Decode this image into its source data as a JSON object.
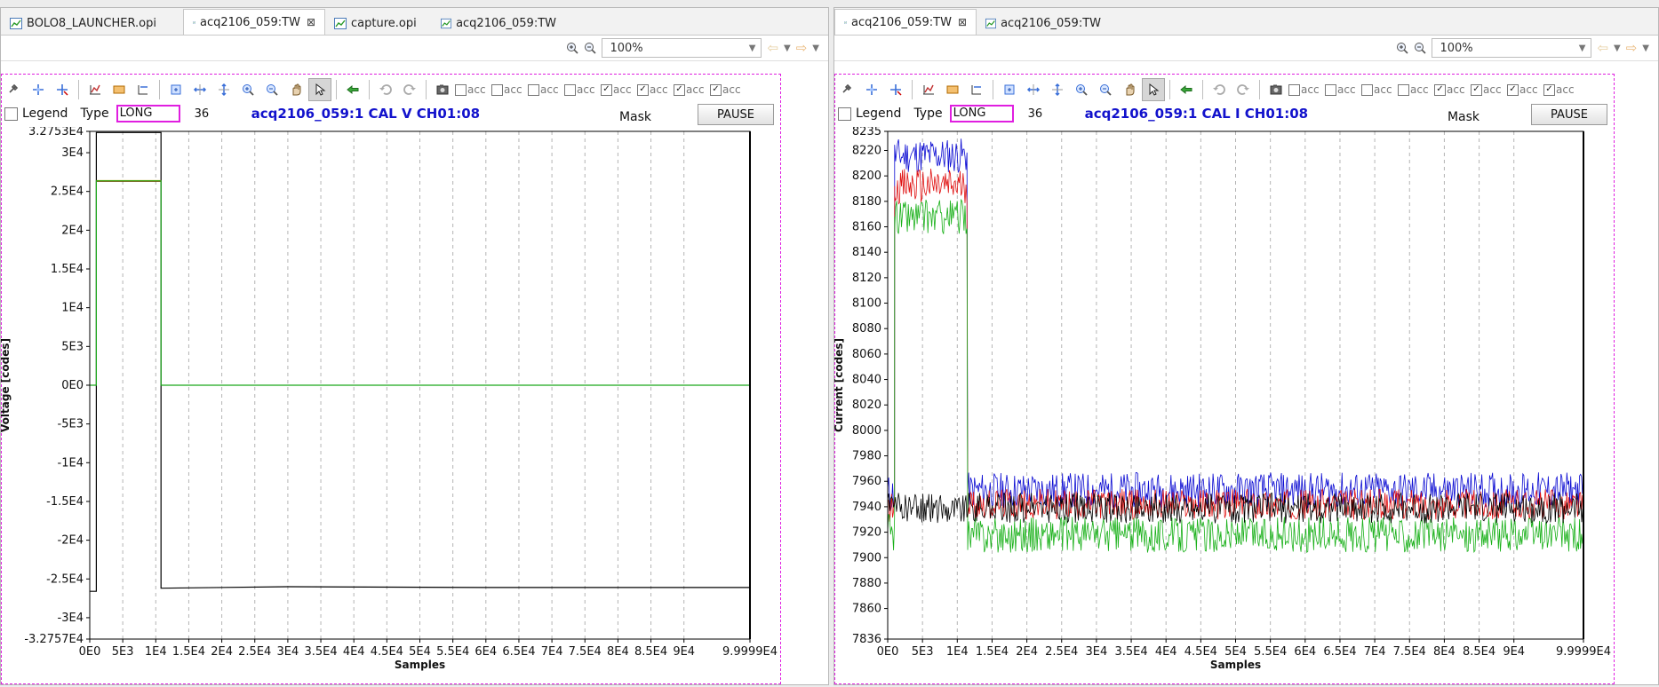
{
  "left": {
    "tabs": [
      {
        "label": "BOLO8_LAUNCHER.opi",
        "active": false,
        "closable": false
      },
      {
        "label": "acq2106_059:TW",
        "active": true,
        "closable": true
      },
      {
        "label": "capture.opi",
        "active": false,
        "closable": false
      },
      {
        "label": "acq2106_059:TW",
        "active": false,
        "closable": false
      }
    ],
    "zoom": "100%",
    "legend_label": "Legend",
    "type_label": "Type",
    "type_value": "LONG",
    "count_value": "36",
    "pv_title": "acq2106_059:1 CAL V CH01:08",
    "mask_label": "Mask",
    "pause_label": "PAUSE",
    "checks": [
      {
        "label": "acc",
        "checked": false
      },
      {
        "label": "acc",
        "checked": false
      },
      {
        "label": "acc",
        "checked": false
      },
      {
        "label": "acc",
        "checked": false
      },
      {
        "label": "acc",
        "checked": true
      },
      {
        "label": "acc",
        "checked": true
      },
      {
        "label": "acc",
        "checked": true
      },
      {
        "label": "acc",
        "checked": true
      }
    ]
  },
  "right": {
    "tabs": [
      {
        "label": "acq2106_059:TW",
        "active": true,
        "closable": true
      },
      {
        "label": "acq2106_059:TW",
        "active": false,
        "closable": false
      }
    ],
    "zoom": "100%",
    "legend_label": "Legend",
    "type_label": "Type",
    "type_value": "LONG",
    "count_value": "36",
    "pv_title": "acq2106_059:1 CAL I CH01:08",
    "mask_label": "Mask",
    "pause_label": "PAUSE",
    "checks": [
      {
        "label": "acc",
        "checked": false
      },
      {
        "label": "acc",
        "checked": false
      },
      {
        "label": "acc",
        "checked": false
      },
      {
        "label": "acc",
        "checked": false
      },
      {
        "label": "acc",
        "checked": true
      },
      {
        "label": "acc",
        "checked": true
      },
      {
        "label": "acc",
        "checked": true
      },
      {
        "label": "acc",
        "checked": true
      }
    ]
  },
  "chart_data": [
    {
      "type": "line",
      "xlabel": "Samples",
      "ylabel": "Voltage [codes]",
      "xlim": [
        0,
        99999
      ],
      "ylim": [
        -32757,
        32753
      ],
      "x_ticks": [
        {
          "value": 0,
          "label": "0E0"
        },
        {
          "value": 5000,
          "label": "5E3"
        },
        {
          "value": 10000,
          "label": "1E4"
        },
        {
          "value": 15000,
          "label": "1.5E4"
        },
        {
          "value": 20000,
          "label": "2E4"
        },
        {
          "value": 25000,
          "label": "2.5E4"
        },
        {
          "value": 30000,
          "label": "3E4"
        },
        {
          "value": 35000,
          "label": "3.5E4"
        },
        {
          "value": 40000,
          "label": "4E4"
        },
        {
          "value": 45000,
          "label": "4.5E4"
        },
        {
          "value": 50000,
          "label": "5E4"
        },
        {
          "value": 55000,
          "label": "5.5E4"
        },
        {
          "value": 60000,
          "label": "6E4"
        },
        {
          "value": 65000,
          "label": "6.5E4"
        },
        {
          "value": 70000,
          "label": "7E4"
        },
        {
          "value": 75000,
          "label": "7.5E4"
        },
        {
          "value": 80000,
          "label": "8E4"
        },
        {
          "value": 85000,
          "label": "8.5E4"
        },
        {
          "value": 90000,
          "label": "9E4"
        },
        {
          "value": 99999,
          "label": "9.9999E4"
        }
      ],
      "y_ticks": [
        {
          "value": 32753,
          "label": "3.2753E4"
        },
        {
          "value": 30000,
          "label": "3E4"
        },
        {
          "value": 25000,
          "label": "2.5E4"
        },
        {
          "value": 20000,
          "label": "2E4"
        },
        {
          "value": 15000,
          "label": "1.5E4"
        },
        {
          "value": 10000,
          "label": "1E4"
        },
        {
          "value": 5000,
          "label": "5E3"
        },
        {
          "value": 0,
          "label": "0E0"
        },
        {
          "value": -5000,
          "label": "-5E3"
        },
        {
          "value": -10000,
          "label": "-1E4"
        },
        {
          "value": -15000,
          "label": "-1.5E4"
        },
        {
          "value": -20000,
          "label": "-2E4"
        },
        {
          "value": -25000,
          "label": "-2.5E4"
        },
        {
          "value": -30000,
          "label": "-3E4"
        },
        {
          "value": -32757,
          "label": "-3.2757E4"
        }
      ],
      "grid": {
        "x": true,
        "y": false
      },
      "series": [
        {
          "color": "#000000",
          "x": [
            0,
            1000,
            1000,
            10800,
            10800,
            30000,
            60000,
            99999
          ],
          "y": [
            -26600,
            -26600,
            32600,
            32600,
            -26200,
            -26000,
            -26100,
            -26100
          ]
        },
        {
          "color": "#c0a000",
          "x": [
            1000,
            10800
          ],
          "y": [
            26400,
            26400
          ]
        },
        {
          "color": "#cc0000",
          "x": [
            1000,
            10800
          ],
          "y": [
            26300,
            26300
          ]
        },
        {
          "color": "#1aa81a",
          "x": [
            0,
            1000,
            1000,
            10800,
            10800,
            99999
          ],
          "y": [
            0,
            0,
            26350,
            26350,
            0,
            0
          ]
        }
      ]
    },
    {
      "type": "line",
      "xlabel": "Samples",
      "ylabel": "Current [codes]",
      "xlim": [
        0,
        99999
      ],
      "ylim": [
        7836,
        8235
      ],
      "x_ticks": [
        {
          "value": 0,
          "label": "0E0"
        },
        {
          "value": 5000,
          "label": "5E3"
        },
        {
          "value": 10000,
          "label": "1E4"
        },
        {
          "value": 15000,
          "label": "1.5E4"
        },
        {
          "value": 20000,
          "label": "2E4"
        },
        {
          "value": 25000,
          "label": "2.5E4"
        },
        {
          "value": 30000,
          "label": "3E4"
        },
        {
          "value": 35000,
          "label": "3.5E4"
        },
        {
          "value": 40000,
          "label": "4E4"
        },
        {
          "value": 45000,
          "label": "4.5E4"
        },
        {
          "value": 50000,
          "label": "5E4"
        },
        {
          "value": 55000,
          "label": "5.5E4"
        },
        {
          "value": 60000,
          "label": "6E4"
        },
        {
          "value": 65000,
          "label": "6.5E4"
        },
        {
          "value": 70000,
          "label": "7E4"
        },
        {
          "value": 75000,
          "label": "7.5E4"
        },
        {
          "value": 80000,
          "label": "8E4"
        },
        {
          "value": 85000,
          "label": "8.5E4"
        },
        {
          "value": 90000,
          "label": "9E4"
        },
        {
          "value": 99999,
          "label": "9.9999E4"
        }
      ],
      "y_ticks": [
        {
          "value": 8235,
          "label": "8235"
        },
        {
          "value": 8220,
          "label": "8220"
        },
        {
          "value": 8200,
          "label": "8200"
        },
        {
          "value": 8180,
          "label": "8180"
        },
        {
          "value": 8160,
          "label": "8160"
        },
        {
          "value": 8140,
          "label": "8140"
        },
        {
          "value": 8120,
          "label": "8120"
        },
        {
          "value": 8100,
          "label": "8100"
        },
        {
          "value": 8080,
          "label": "8080"
        },
        {
          "value": 8060,
          "label": "8060"
        },
        {
          "value": 8040,
          "label": "8040"
        },
        {
          "value": 8020,
          "label": "8020"
        },
        {
          "value": 8000,
          "label": "8000"
        },
        {
          "value": 7980,
          "label": "7980"
        },
        {
          "value": 7960,
          "label": "7960"
        },
        {
          "value": 7940,
          "label": "7940"
        },
        {
          "value": 7920,
          "label": "7920"
        },
        {
          "value": 7900,
          "label": "7900"
        },
        {
          "value": 7880,
          "label": "7880"
        },
        {
          "value": 7860,
          "label": "7860"
        },
        {
          "value": 7836,
          "label": "7836"
        }
      ],
      "grid": {
        "x": true,
        "y": false
      },
      "series": [
        {
          "color": "#0a0ad2",
          "segments": [
            {
              "x0": 0,
              "x1": 1000,
              "center": 7950,
              "noise": 16
            },
            {
              "x0": 1000,
              "x1": 11500,
              "center": 8216,
              "noise": 14
            },
            {
              "x0": 11500,
              "x1": 99999,
              "center": 7953,
              "noise": 14
            }
          ]
        },
        {
          "color": "#e01010",
          "segments": [
            {
              "x0": 0,
              "x1": 1000,
              "center": 7940,
              "noise": 12
            },
            {
              "x0": 1000,
              "x1": 11500,
              "center": 8192,
              "noise": 14
            },
            {
              "x0": 11500,
              "x1": 99999,
              "center": 7942,
              "noise": 12
            }
          ]
        },
        {
          "color": "#18b018",
          "segments": [
            {
              "x0": 0,
              "x1": 1000,
              "center": 7920,
              "noise": 16
            },
            {
              "x0": 1000,
              "x1": 11500,
              "center": 8168,
              "noise": 14
            },
            {
              "x0": 11500,
              "x1": 99999,
              "center": 7918,
              "noise": 14
            }
          ]
        },
        {
          "color": "#000000",
          "segments": [
            {
              "x0": 0,
              "x1": 99999,
              "center": 7939,
              "noise": 12
            }
          ]
        }
      ]
    }
  ]
}
